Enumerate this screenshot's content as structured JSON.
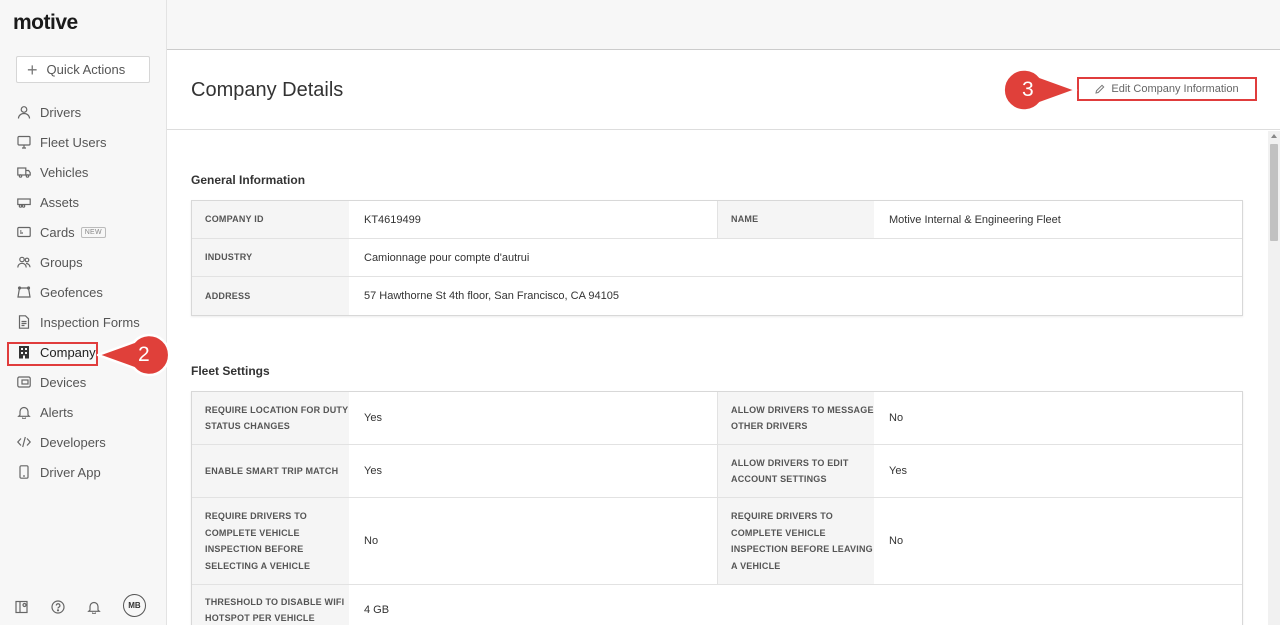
{
  "app": {
    "logo": "motive"
  },
  "sidebar": {
    "quick_actions": "Quick Actions",
    "items": [
      {
        "label": "Drivers",
        "icon": "person-icon"
      },
      {
        "label": "Fleet Users",
        "icon": "monitor-icon"
      },
      {
        "label": "Vehicles",
        "icon": "truck-icon"
      },
      {
        "label": "Assets",
        "icon": "trailer-icon"
      },
      {
        "label": "Cards",
        "icon": "card-icon",
        "badge": "NEW"
      },
      {
        "label": "Groups",
        "icon": "group-icon"
      },
      {
        "label": "Geofences",
        "icon": "geofence-icon"
      },
      {
        "label": "Inspection Forms",
        "icon": "document-icon"
      },
      {
        "label": "Company",
        "icon": "building-icon",
        "active": true
      },
      {
        "label": "Devices",
        "icon": "device-icon"
      },
      {
        "label": "Alerts",
        "icon": "bell-icon"
      },
      {
        "label": "Developers",
        "icon": "code-icon"
      },
      {
        "label": "Driver App",
        "icon": "phone-icon"
      }
    ],
    "footer": {
      "avatar": "MB"
    }
  },
  "header": {
    "title": "Company Details",
    "edit_button": "Edit Company Information"
  },
  "steps": {
    "two": "2",
    "three": "3"
  },
  "general": {
    "title": "General Information",
    "company_id_label": "COMPANY ID",
    "company_id": "KT4619499",
    "name_label": "NAME",
    "name": "Motive Internal & Engineering Fleet",
    "industry_label": "INDUSTRY",
    "industry": "Camionnage pour compte d'autrui",
    "address_label": "ADDRESS",
    "address": "57 Hawthorne St 4th floor, San Francisco, CA 94105"
  },
  "fleet": {
    "title": "Fleet Settings",
    "rows": [
      {
        "l1": "REQUIRE LOCATION FOR DUTY STATUS CHANGES",
        "v1": "Yes",
        "l2": "ALLOW DRIVERS TO MESSAGE OTHER DRIVERS",
        "v2": "No"
      },
      {
        "l1": "ENABLE SMART TRIP MATCH",
        "v1": "Yes",
        "l2": "ALLOW DRIVERS TO EDIT ACCOUNT SETTINGS",
        "v2": "Yes"
      },
      {
        "l1": "REQUIRE DRIVERS TO COMPLETE VEHICLE INSPECTION BEFORE SELECTING A VEHICLE",
        "v1": "No",
        "l2": "REQUIRE DRIVERS TO COMPLETE VEHICLE INSPECTION BEFORE LEAVING A VEHICLE",
        "v2": "No"
      },
      {
        "l1": "THRESHOLD TO DISABLE WIFI HOTSPOT PER VEHICLE",
        "v1": "4 GB"
      }
    ]
  },
  "colors": {
    "highlight": "#e03c3c",
    "sidebar_bg": "#f7f7f7"
  }
}
